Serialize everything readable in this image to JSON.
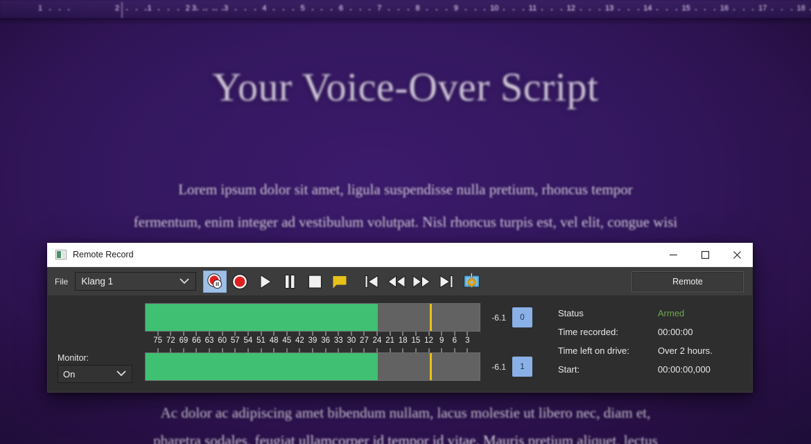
{
  "document": {
    "title": "Your Voice-Over Script",
    "lines": [
      "Lorem ipsum dolor sit amet, ligula suspendisse nulla pretium, rhoncus tempor",
      "fermentum, enim integer ad vestibulum volutpat. Nisl rhoncus turpis est, vel elit, congue wisi",
      "Ac dolor ac adipiscing amet bibendum nullam, lacus molestie ut libero nec, diam et,",
      "pharetra sodales, feugiat ullamcorper id tempor id vitae. Mauris pretium aliquet, lectus"
    ],
    "ruler": {
      "numbers": [
        1,
        2,
        3,
        1,
        2,
        3,
        4,
        5,
        6,
        7,
        8,
        9,
        10,
        11,
        12,
        13,
        14,
        15,
        16,
        17,
        18
      ]
    }
  },
  "window": {
    "title": "Remote Record",
    "icon": "app-icon",
    "controls": {
      "minimize": "–",
      "maximize": "□",
      "close": "✕"
    }
  },
  "toolbar": {
    "file_label": "File",
    "preset": {
      "value": "Klang 1",
      "placeholder": "Klang 1"
    },
    "remote_label": "Remote",
    "buttons": [
      {
        "name": "record-pause-button",
        "icon": "record-pause-icon",
        "active": true
      },
      {
        "name": "record-button",
        "icon": "record-icon",
        "active": false
      },
      {
        "name": "play-button",
        "icon": "play-icon",
        "active": false
      },
      {
        "name": "pause-button",
        "icon": "pause-icon",
        "active": false
      },
      {
        "name": "stop-button",
        "icon": "stop-icon",
        "active": false
      },
      {
        "name": "marker-button",
        "icon": "marker-flag-icon",
        "active": false
      },
      {
        "name": "skip-to-start-button",
        "icon": "skip-start-icon",
        "active": false
      },
      {
        "name": "rewind-button",
        "icon": "rewind-icon",
        "active": false
      },
      {
        "name": "fast-forward-button",
        "icon": "fast-forward-icon",
        "active": false
      },
      {
        "name": "skip-to-end-button",
        "icon": "skip-end-icon",
        "active": false
      },
      {
        "name": "settings-button",
        "icon": "monitor-gear-icon",
        "active": false
      }
    ]
  },
  "monitor": {
    "label": "Monitor:",
    "value": "On"
  },
  "meters": {
    "scale_labels": [
      75,
      72,
      69,
      66,
      63,
      60,
      57,
      54,
      51,
      48,
      45,
      42,
      39,
      36,
      33,
      30,
      27,
      24,
      21,
      18,
      15,
      12,
      9,
      6,
      3
    ],
    "scale_max": 78,
    "peak_marker_db": 12,
    "channels": [
      {
        "id": "0",
        "db": "-6.1",
        "level_db": 24
      },
      {
        "id": "1",
        "db": "-6.1",
        "level_db": 24
      }
    ],
    "fill_color": "#3fc072",
    "peak_color": "#e8c219",
    "channel_badge_color": "#8ab0e8"
  },
  "status": {
    "rows": [
      {
        "key": "Status",
        "value": "Armed",
        "accent": true
      },
      {
        "key": "Time recorded:",
        "value": "00:00:00",
        "accent": false
      },
      {
        "key": "Time left on drive:",
        "value": "Over 2 hours.",
        "accent": false
      },
      {
        "key": "Start:",
        "value": "00:00:00,000",
        "accent": false
      }
    ],
    "armed_color": "#6fa84f"
  }
}
